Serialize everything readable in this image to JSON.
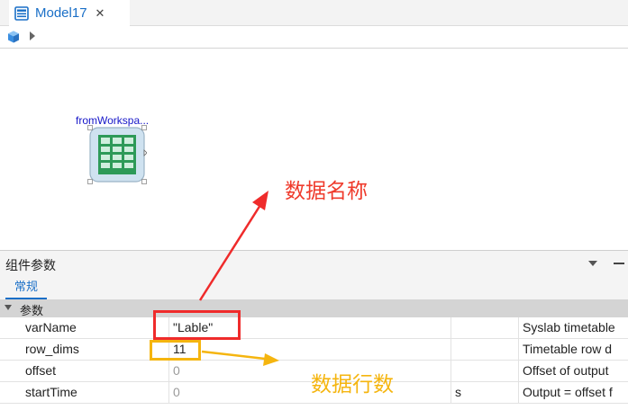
{
  "tabbar": {
    "tab_label": "Model17",
    "tab_icon": "model-document-icon",
    "close_glyph": "✕"
  },
  "breadcrumb": {
    "root_icon": "cube-icon",
    "separator_icon": "chevron-right-icon"
  },
  "canvas": {
    "block_label": "fromWorkspa...",
    "block_icon": "table-grid-icon",
    "annotations": {
      "name": "数据名称",
      "rows": "数据行数"
    }
  },
  "panel": {
    "title": "组件参数",
    "subtab": "常规",
    "section_title": "参数",
    "params": [
      {
        "name": "varName",
        "value": "\"Lable\"",
        "unit": "",
        "description": "Syslab timetable"
      },
      {
        "name": "row_dims",
        "value": "11",
        "unit": "",
        "description": "Timetable row d"
      },
      {
        "name": "offset",
        "value": "0",
        "unit": "",
        "description": "Offset of output"
      },
      {
        "name": "startTime",
        "value": "0",
        "unit": "s",
        "description": "Output = offset f"
      }
    ]
  },
  "colors": {
    "accent": "#1a6fc7",
    "annotation_red": "#ef3b2c",
    "annotation_orange": "#f5b50f",
    "block_green": "#2e9a58",
    "block_fill": "#cfe2f0"
  }
}
